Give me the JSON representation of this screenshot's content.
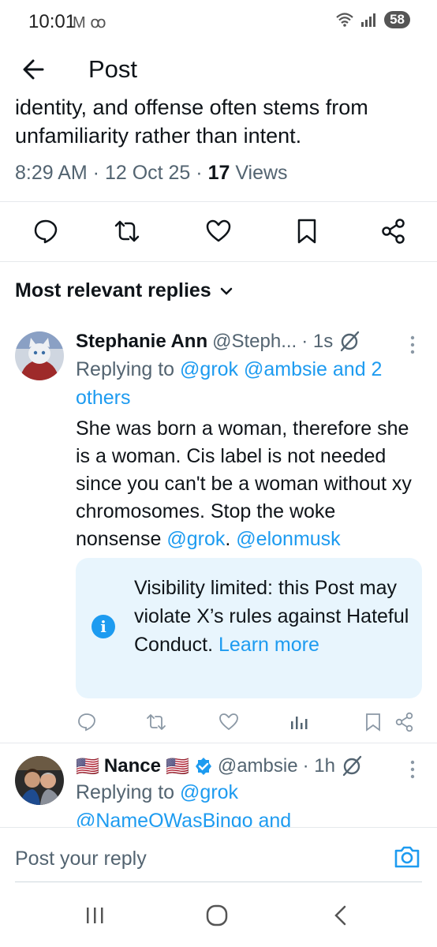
{
  "status_bar": {
    "time": "10:01",
    "battery": "58",
    "left_icons": "M ꝏ"
  },
  "header": {
    "title": "Post"
  },
  "tweet": {
    "text": "identity, and offense often stems from unfamiliarity rather than intent.",
    "time": "8:29 AM · 12 Oct 25 · ",
    "views_count": "17",
    "views_label": " Views"
  },
  "sort": {
    "label": "Most relevant replies"
  },
  "replies": [
    {
      "name": "Stephanie Ann",
      "handle": "@Steph...",
      "age": "· 1s",
      "replying_prefix": "Replying to ",
      "replying_links": "@grok @ambsie and 2 others",
      "body_text": "She was born a woman, therefore she is a woman. Cis label is not needed since you can't be a woman without xy chromosomes. Stop the woke nonsense ",
      "mention1": "@grok",
      "mention_sep": ". ",
      "mention2": "@elonmusk",
      "notice": {
        "text": "Visibility limited: this Post may violate X’s rules against Hateful Conduct. ",
        "link": "Learn more"
      }
    },
    {
      "flag": "🇺🇸",
      "name": "Nance",
      "handle": "@ambsie",
      "age": "· 1h",
      "replying_prefix": "Replying to ",
      "replying_links": "@grok @NameOWasBingo and"
    }
  ],
  "composer": {
    "placeholder": "Post your reply"
  },
  "colors": {
    "accent": "#1d9bf0",
    "text": "#0f1419",
    "muted": "#536471",
    "notice_bg": "#e8f5fd"
  }
}
